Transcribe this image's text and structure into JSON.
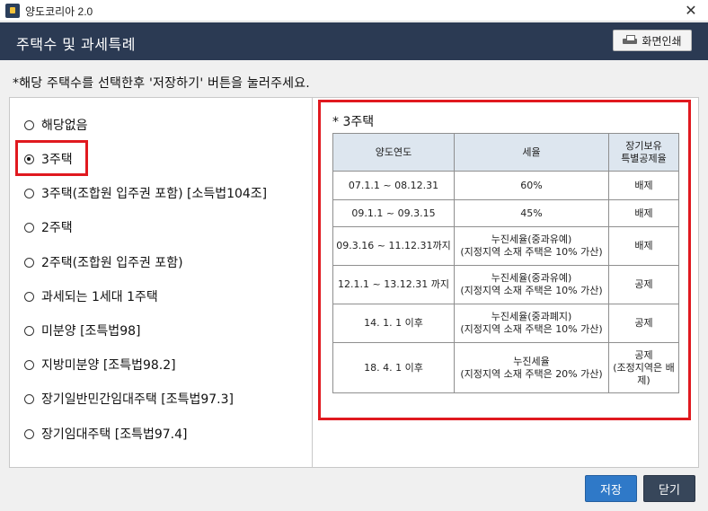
{
  "window": {
    "title": "양도코리아 2.0",
    "close_glyph": "✕"
  },
  "header": {
    "title": "주택수 및 과세특례",
    "print_label": "화면인쇄"
  },
  "instruction": "*해당 주택수를 선택한후 '저장하기' 버튼을 눌러주세요.",
  "options": [
    {
      "label": "해당없음",
      "selected": false
    },
    {
      "label": "3주택",
      "selected": true
    },
    {
      "label": "3주택(조합원 입주권 포함) [소득법104조]",
      "selected": false
    },
    {
      "label": "2주택",
      "selected": false
    },
    {
      "label": "2주택(조합원 입주권 포함)",
      "selected": false
    },
    {
      "label": "과세되는 1세대 1주택",
      "selected": false
    },
    {
      "label": "미분양 [조특법98]",
      "selected": false
    },
    {
      "label": "지방미분양 [조특법98.2]",
      "selected": false
    },
    {
      "label": "장기일반민간임대주택 [조특법97.3]",
      "selected": false
    },
    {
      "label": "장기임대주택 [조특법97.4]",
      "selected": false
    }
  ],
  "details": {
    "title": "* 3주택",
    "columns": [
      "양도연도",
      "세율",
      "장기보유",
      "특별공제율"
    ],
    "rows": [
      {
        "period": "07.1.1 ~ 08.12.31",
        "rate": "60%",
        "rate_note": "",
        "deduction": "배제",
        "deduction_note": ""
      },
      {
        "period": "09.1.1 ~ 09.3.15",
        "rate": "45%",
        "rate_note": "",
        "deduction": "배제",
        "deduction_note": ""
      },
      {
        "period": "09.3.16 ~ 11.12.31까지",
        "rate": "누진세율(중과유예)",
        "rate_note": "(지정지역 소재 주택은 10% 가산)",
        "deduction": "배제",
        "deduction_note": ""
      },
      {
        "period": "12.1.1 ~ 13.12.31 까지",
        "rate": "누진세율(중과유예)",
        "rate_note": "(지정지역 소재 주택은 10% 가산)",
        "deduction": "공제",
        "deduction_note": ""
      },
      {
        "period": "14. 1. 1 이후",
        "rate": "누진세율(중과폐지)",
        "rate_note": "(지정지역 소재 주택은 10% 가산)",
        "deduction": "공제",
        "deduction_note": ""
      },
      {
        "period": "18. 4. 1 이후",
        "rate": "누진세율",
        "rate_note": "(지정지역 소재 주택은 20% 가산)",
        "deduction": "공제",
        "deduction_note": "(조정지역은 배제)"
      }
    ]
  },
  "buttons": {
    "save_label": "저장",
    "close_label": "닫기"
  },
  "colors": {
    "header_bg": "#2b3a53",
    "highlight": "#e0191f",
    "save_bg": "#2f79c8",
    "close_bg": "#37465a",
    "table_header_bg": "#dde6ef"
  }
}
